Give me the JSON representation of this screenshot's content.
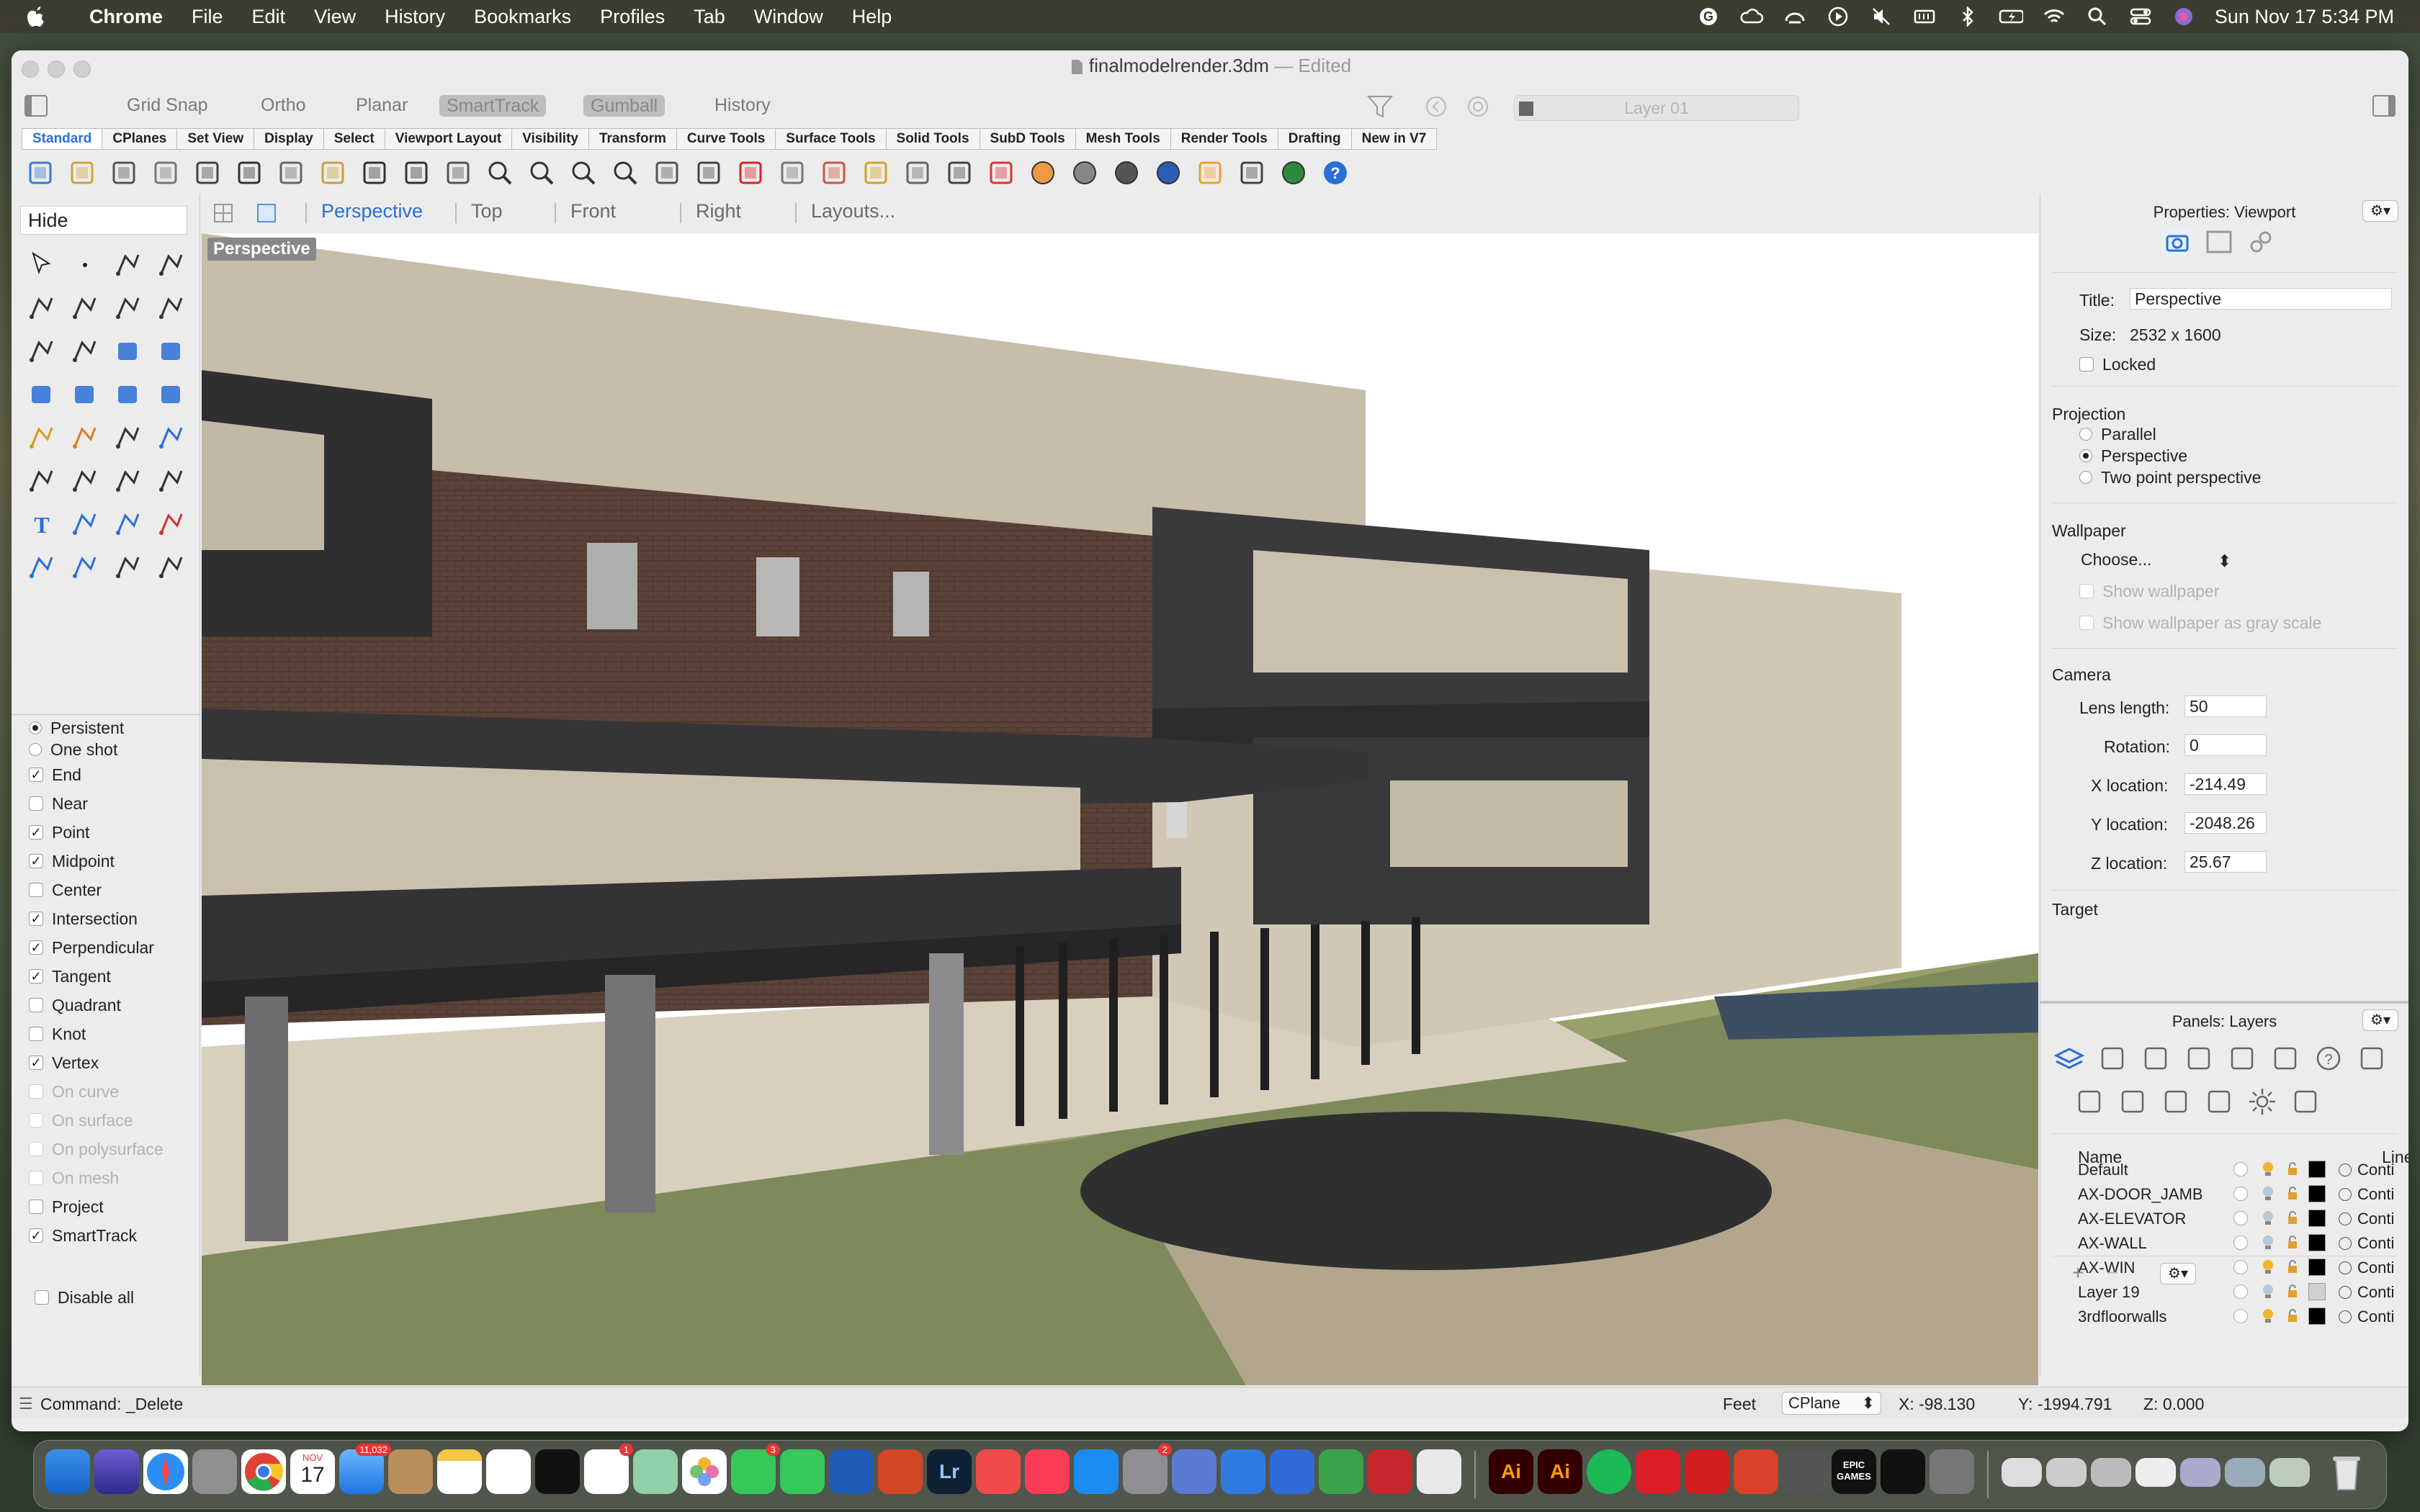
{
  "menubar": {
    "app": "Chrome",
    "items": [
      "File",
      "Edit",
      "View",
      "History",
      "Bookmarks",
      "Profiles",
      "Tab",
      "Window",
      "Help"
    ],
    "clock": "Sun Nov 17  5:34 PM"
  },
  "window": {
    "file_title": "finalmodelrender.3dm",
    "edited": "Edited",
    "separator": "—"
  },
  "modes": [
    {
      "label": "Grid Snap",
      "on": false
    },
    {
      "label": "Ortho",
      "on": false
    },
    {
      "label": "Planar",
      "on": false
    },
    {
      "label": "SmartTrack",
      "on": true
    },
    {
      "label": "Gumball",
      "on": true
    },
    {
      "label": "History",
      "on": false
    }
  ],
  "layer_box": "Layer 01",
  "tabs": [
    "Standard",
    "CPlanes",
    "Set View",
    "Display",
    "Select",
    "Viewport Layout",
    "Visibility",
    "Transform",
    "Curve Tools",
    "Surface Tools",
    "Solid Tools",
    "SubD Tools",
    "Mesh Tools",
    "Render Tools",
    "Drafting",
    "New in V7"
  ],
  "toolbar_icons": [
    "new-icon",
    "open-icon",
    "save-icon",
    "print-icon",
    "import-icon",
    "cut-icon",
    "copy-icon",
    "paste-icon",
    "undo-icon",
    "pan-icon",
    "rotate-view-icon",
    "zoom-icon",
    "zoom-window-icon",
    "zoom-extents-icon",
    "zoom-selected-icon",
    "rotate-camera-icon",
    "four-viewports-icon",
    "car-icon",
    "grid-plane-icon",
    "cplane-icon",
    "lights-icon",
    "lightbulb-icon",
    "lock-icon",
    "layer-icon",
    "color-wheel-icon",
    "shaded-sphere-icon",
    "rendered-sphere-icon",
    "globe-icon",
    "pen-icon",
    "dimension-icon",
    "render-icon",
    "help-icon"
  ],
  "command_box": "Hide",
  "left_tools": [
    "select-arrow-icon",
    "point-icon",
    "polyline-icon",
    "curve-icon",
    "circle-icon",
    "ellipse-icon",
    "polygon-icon",
    "rectangle-icon",
    "circle-point-icon",
    "arc-icon",
    "surface-icon",
    "loft-icon",
    "box-icon",
    "sphere-icon",
    "cylinder-icon",
    "extrude-icon",
    "gears-icon",
    "explode-icon",
    "transform-icon",
    "fillet-icon",
    "boolean-icon",
    "rotate-icon",
    "curve-edit-icon",
    "offset-icon",
    "text-icon",
    "scale-icon",
    "array-icon",
    "align-icon",
    "cube-icon",
    "dimension-icon",
    "grid-array-icon",
    "move-icon"
  ],
  "osnap": [
    {
      "label": "Persistent",
      "type": "radio",
      "checked": true,
      "dim": false
    },
    {
      "label": "One shot",
      "type": "radio",
      "checked": false,
      "dim": false
    },
    {
      "label": "End",
      "type": "check",
      "checked": true,
      "dim": false
    },
    {
      "label": "Near",
      "type": "check",
      "checked": false,
      "dim": false
    },
    {
      "label": "Point",
      "type": "check",
      "checked": true,
      "dim": false
    },
    {
      "label": "Midpoint",
      "type": "check",
      "checked": true,
      "dim": false
    },
    {
      "label": "Center",
      "type": "check",
      "checked": false,
      "dim": false
    },
    {
      "label": "Intersection",
      "type": "check",
      "checked": true,
      "dim": false
    },
    {
      "label": "Perpendicular",
      "type": "check",
      "checked": true,
      "dim": false
    },
    {
      "label": "Tangent",
      "type": "check",
      "checked": true,
      "dim": false
    },
    {
      "label": "Quadrant",
      "type": "check",
      "checked": false,
      "dim": false
    },
    {
      "label": "Knot",
      "type": "check",
      "checked": false,
      "dim": false
    },
    {
      "label": "Vertex",
      "type": "check",
      "checked": true,
      "dim": false
    },
    {
      "label": "On curve",
      "type": "check",
      "checked": false,
      "dim": true
    },
    {
      "label": "On surface",
      "type": "check",
      "checked": false,
      "dim": true
    },
    {
      "label": "On polysurface",
      "type": "check",
      "checked": false,
      "dim": true
    },
    {
      "label": "On mesh",
      "type": "check",
      "checked": false,
      "dim": true
    },
    {
      "label": "Project",
      "type": "check",
      "checked": false,
      "dim": false
    },
    {
      "label": "SmartTrack",
      "type": "check",
      "checked": true,
      "dim": false
    }
  ],
  "disable_all": "Disable all",
  "viewport_tabs": [
    "Perspective",
    "Top",
    "Front",
    "Right",
    "Layouts..."
  ],
  "viewport_label": "Perspective",
  "properties": {
    "header": "Properties: Viewport",
    "title_label": "Title:",
    "title_value": "Perspective",
    "size_label": "Size:",
    "size_value": "2532 x 1600",
    "locked": "Locked",
    "projection": "Projection",
    "proj_options": [
      {
        "label": "Parallel",
        "checked": false
      },
      {
        "label": "Perspective",
        "checked": true
      },
      {
        "label": "Two point perspective",
        "checked": false
      }
    ],
    "wallpaper": "Wallpaper",
    "choose": "Choose...",
    "show_wallpaper": "Show wallpaper",
    "show_gray": "Show wallpaper as gray scale",
    "camera": "Camera",
    "lens_label": "Lens length:",
    "lens_value": "50",
    "rotation_label": "Rotation:",
    "rotation_value": "0",
    "x_label": "X location:",
    "x_value": "-214.49",
    "y_label": "Y location:",
    "y_value": "-2048.26",
    "z_label": "Z location:",
    "z_value": "25.67",
    "target": "Target"
  },
  "layers": {
    "header": "Panels: Layers",
    "name_col": "Name",
    "linetype_col": "Linet",
    "rows": [
      {
        "name": "Default",
        "bulb_on": true,
        "color": "#000000",
        "line": "Conti"
      },
      {
        "name": "AX-DOOR_JAMB",
        "bulb_on": false,
        "color": "#000000",
        "line": "Conti"
      },
      {
        "name": "AX-ELEVATOR",
        "bulb_on": false,
        "color": "#000000",
        "line": "Conti"
      },
      {
        "name": "AX-WALL",
        "bulb_on": false,
        "color": "#000000",
        "line": "Conti"
      },
      {
        "name": "AX-WIN",
        "bulb_on": true,
        "color": "#000000",
        "line": "Conti"
      },
      {
        "name": "Layer 19",
        "bulb_on": false,
        "color": "#d0d0d0",
        "line": "Conti"
      },
      {
        "name": "3rdfloorwalls",
        "bulb_on": true,
        "color": "#000000",
        "line": "Conti"
      }
    ]
  },
  "status": {
    "command": "Command: _Delete",
    "units": "Feet",
    "cplane": "CPlane",
    "x": "X: -98.130",
    "y": "Y: -1994.791",
    "z": "Z: 0.000"
  },
  "dock_badges": {
    "calendar_month": "NOV",
    "calendar_day": "17",
    "mail": "11,032",
    "reminders": "1",
    "messages": "3",
    "settings": "2"
  },
  "dock_labels": {
    "lr": "Lr",
    "ai": "Ai",
    "epic": "EPIC GAMES"
  }
}
